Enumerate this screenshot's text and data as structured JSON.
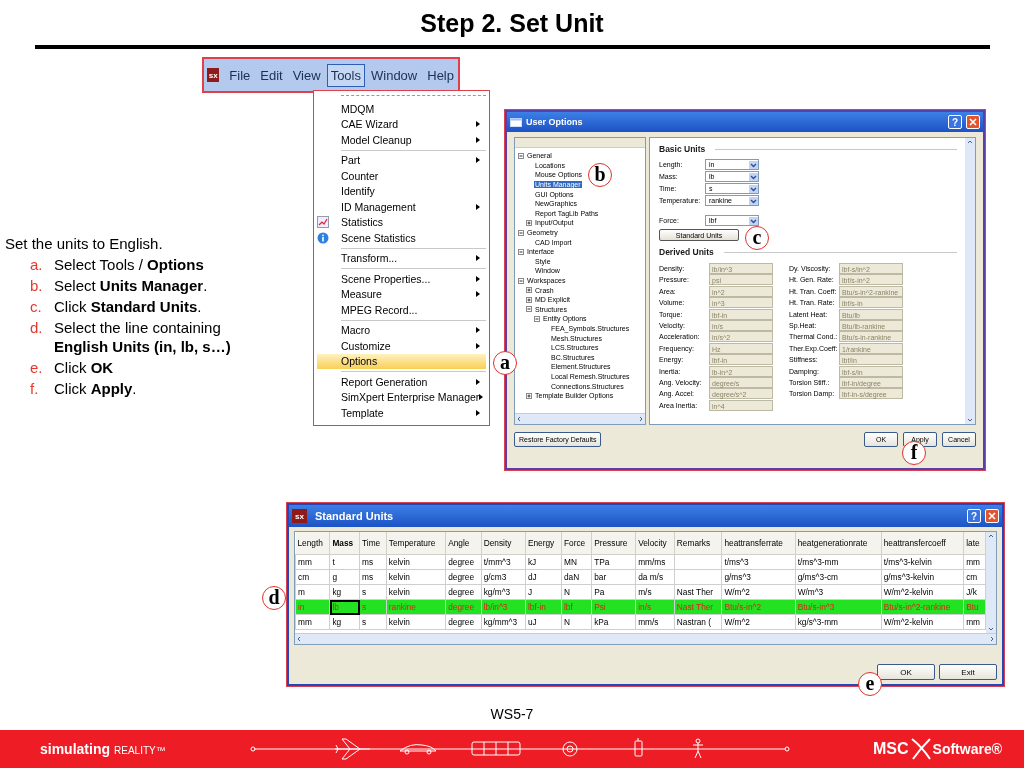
{
  "slide_title": "Step 2. Set Unit",
  "instructions": {
    "intro": "Set the units to English.",
    "steps": [
      {
        "marker": "a.",
        "text": "Select Tools / **Options**"
      },
      {
        "marker": "b.",
        "text": "Select **Units Manager**."
      },
      {
        "marker": "c.",
        "text": "Click **Standard Units**."
      },
      {
        "marker": "d.",
        "text": "Select the line containing **English Units (in, lb, s…)**"
      },
      {
        "marker": "e.",
        "text": "Click **OK**"
      },
      {
        "marker": "f.",
        "text": "Click **Apply**."
      }
    ]
  },
  "menubar": {
    "logo": "sx",
    "items": [
      {
        "label": "File",
        "selected": false
      },
      {
        "label": "Edit",
        "selected": false
      },
      {
        "label": "View",
        "selected": false
      },
      {
        "label": "Tools",
        "selected": true
      },
      {
        "label": "Window",
        "selected": false
      },
      {
        "label": "Help",
        "selected": false
      }
    ]
  },
  "tools_menu": {
    "groups": [
      [
        {
          "label": "MDQM",
          "kind": "plain",
          "submenu": false,
          "selected": false
        },
        {
          "label": "CAE Wizard",
          "kind": "plain",
          "submenu": true,
          "selected": false
        },
        {
          "label": "Model Cleanup",
          "kind": "plain",
          "submenu": true,
          "selected": false
        }
      ],
      [
        {
          "label": "Part",
          "kind": "plain",
          "submenu": true,
          "selected": false
        },
        {
          "label": "Counter",
          "kind": "plain",
          "submenu": false,
          "selected": false
        },
        {
          "label": "Identify",
          "kind": "plain",
          "submenu": false,
          "selected": false
        },
        {
          "label": "ID Management",
          "kind": "plain",
          "submenu": true,
          "selected": false
        },
        {
          "label": "Statistics",
          "kind": "chart",
          "submenu": false,
          "selected": false
        },
        {
          "label": "Scene Statistics",
          "kind": "info",
          "submenu": false,
          "selected": false
        }
      ],
      [
        {
          "label": "Transform...",
          "kind": "plain",
          "submenu": true,
          "selected": false
        }
      ],
      [
        {
          "label": "Scene Properties...",
          "kind": "plain",
          "submenu": true,
          "selected": false
        },
        {
          "label": "Measure",
          "kind": "plain",
          "submenu": true,
          "selected": false
        },
        {
          "label": "MPEG Record...",
          "kind": "plain",
          "submenu": false,
          "selected": false
        }
      ],
      [
        {
          "label": "Macro",
          "kind": "plain",
          "submenu": true,
          "selected": false
        },
        {
          "label": "Customize",
          "kind": "plain",
          "submenu": true,
          "selected": false
        },
        {
          "label": "Options",
          "kind": "plain",
          "submenu": false,
          "selected": true
        }
      ],
      [
        {
          "label": "Report Generation",
          "kind": "plain",
          "submenu": true,
          "selected": false
        },
        {
          "label": "SimXpert Enterprise Manager",
          "kind": "plain",
          "submenu": true,
          "selected": false
        },
        {
          "label": "Template",
          "kind": "plain",
          "submenu": true,
          "selected": false
        }
      ]
    ]
  },
  "user_options": {
    "title": "User Options",
    "help_label": "?",
    "tree": [
      {
        "label": "General",
        "selected": false,
        "expanded": true,
        "children": [
          {
            "label": "Locations",
            "selected": false
          },
          {
            "label": "Mouse Options",
            "selected": false
          },
          {
            "label": "Units Manager",
            "selected": true
          },
          {
            "label": "GUI Options",
            "selected": false
          },
          {
            "label": "NewGraphics",
            "selected": false
          },
          {
            "label": "Report TagLib Paths",
            "selected": false
          },
          {
            "label": "Input/Output",
            "selected": false,
            "expanded": false
          }
        ]
      },
      {
        "label": "Geometry",
        "selected": false,
        "expanded": true,
        "children": [
          {
            "label": "CAD Import",
            "selected": false
          }
        ]
      },
      {
        "label": "Interface",
        "selected": false,
        "expanded": true,
        "children": [
          {
            "label": "Style",
            "selected": false
          },
          {
            "label": "Window",
            "selected": false
          }
        ]
      },
      {
        "label": "Workspaces",
        "selected": false,
        "expanded": true,
        "children": [
          {
            "label": "Crash",
            "selected": false,
            "expanded": false
          },
          {
            "label": "MD Explicit",
            "selected": false,
            "expanded": false
          },
          {
            "label": "Structures",
            "selected": false,
            "expanded": true,
            "children": [
              {
                "label": "Entity Options",
                "selected": false,
                "expanded": true,
                "children": [
                  {
                    "label": "FEA_Symbols.Structures",
                    "selected": false
                  },
                  {
                    "label": "Mesh.Structures",
                    "selected": false
                  },
                  {
                    "label": "LCS.Structures",
                    "selected": false
                  },
                  {
                    "label": "BC.Structures",
                    "selected": false
                  },
                  {
                    "label": "Element.Structures",
                    "selected": false
                  },
                  {
                    "label": "Local Remesh.Structures",
                    "selected": false
                  },
                  {
                    "label": "Connections.Structures",
                    "selected": false
                  }
                ]
              }
            ]
          },
          {
            "label": "Template Builder Options",
            "selected": false,
            "expanded": false
          }
        ]
      }
    ],
    "basic_units": {
      "heading": "Basic Units",
      "fields": [
        {
          "label": "Length:",
          "value": "in"
        },
        {
          "label": "Mass:",
          "value": "lb"
        },
        {
          "label": "Time:",
          "value": "s"
        },
        {
          "label": "Temperature:",
          "value": "rankine"
        }
      ],
      "force": {
        "label": "Force:",
        "value": "lbf"
      },
      "button": "Standard Units"
    },
    "derived_units": {
      "heading": "Derived Units",
      "left": [
        {
          "label": "Density:",
          "value": "lb/in^3"
        },
        {
          "label": "Pressure:",
          "value": "psi"
        },
        {
          "label": "Area:",
          "value": "in^2"
        },
        {
          "label": "Volume:",
          "value": "in^3"
        },
        {
          "label": "Torque:",
          "value": "lbf-in"
        },
        {
          "label": "Velocity:",
          "value": "in/s"
        },
        {
          "label": "Acceleration:",
          "value": "in/s^2"
        },
        {
          "label": "Frequency:",
          "value": "Hz"
        },
        {
          "label": "Energy:",
          "value": "lbf-in"
        },
        {
          "label": "Inertia:",
          "value": "lb-in^2"
        },
        {
          "label": "Ang. Velocity:",
          "value": "degree/s"
        },
        {
          "label": "Ang. Accel:",
          "value": "degree/s^2"
        },
        {
          "label": "Area Inertia:",
          "value": "in^4"
        }
      ],
      "right": [
        {
          "label": "Dy. Viscosity:",
          "value": "lbf-s/in^2"
        },
        {
          "label": "Ht. Gen. Rate:",
          "value": "lbf/s-in^2"
        },
        {
          "label": "Ht. Tran. Coeff:",
          "value": "Btu/s-in^2-rankine"
        },
        {
          "label": "Ht. Tran. Rate:",
          "value": "lbf/s-in"
        },
        {
          "label": "Latent Heat:",
          "value": "Btu/lb"
        },
        {
          "label": "Sp.Heat:",
          "value": "Btu/lb-rankine"
        },
        {
          "label": "Thermal Cond.:",
          "value": "Btu/s-in-rankine"
        },
        {
          "label": "Ther.Exp.Coeff:",
          "value": "1/rankine"
        },
        {
          "label": "Stiffness:",
          "value": "lbf/in"
        },
        {
          "label": "Damping:",
          "value": "lbf-s/in"
        },
        {
          "label": "Torsion Stiff.:",
          "value": "lbf-in/degree"
        },
        {
          "label": "Torsion Damp:",
          "value": "lbf-in-s/degree"
        }
      ]
    },
    "buttons": {
      "restore": "Restore Factory Defaults",
      "ok": "OK",
      "apply": "Apply",
      "cancel": "Cancel"
    }
  },
  "standard_units": {
    "title": "Standard Units",
    "logo": "sx",
    "help_label": "?",
    "columns": [
      {
        "label": "Length",
        "sorted": false
      },
      {
        "label": "Mass",
        "sorted": true
      },
      {
        "label": "Time",
        "sorted": false
      },
      {
        "label": "Temperature",
        "sorted": false
      },
      {
        "label": "Angle",
        "sorted": false
      },
      {
        "label": "Density",
        "sorted": false
      },
      {
        "label": "Energy",
        "sorted": false
      },
      {
        "label": "Force",
        "sorted": false
      },
      {
        "label": "Pressure",
        "sorted": false
      },
      {
        "label": "Velocity",
        "sorted": false
      },
      {
        "label": "Remarks",
        "sorted": false
      },
      {
        "label": "heattransferrate",
        "sorted": false
      },
      {
        "label": "heatgenerationrate",
        "sorted": false
      },
      {
        "label": "heattransfercoeff",
        "sorted": false
      },
      {
        "label": "late",
        "sorted": false
      }
    ],
    "rows": [
      {
        "selected": false,
        "focused": false,
        "cells": [
          "mm",
          "t",
          "ms",
          "kelvin",
          "degree",
          "t/mm^3",
          "kJ",
          "MN",
          "TPa",
          "mm/ms",
          null,
          "t/ms^3",
          "t/ms^3-mm",
          "t/ms^3-kelvin",
          "mm"
        ]
      },
      {
        "selected": false,
        "focused": false,
        "cells": [
          "cm",
          "g",
          "ms",
          "kelvin",
          "degree",
          "g/cm3",
          "dJ",
          "daN",
          "bar",
          "da m/s",
          null,
          "g/ms^3",
          "g/ms^3-cm",
          "g/ms^3-kelvin",
          "cm"
        ]
      },
      {
        "selected": false,
        "focused": false,
        "cells": [
          "m",
          "kg",
          "s",
          "kelvin",
          "degree",
          "kg/m^3",
          "J",
          "N",
          "Pa",
          "m/s",
          "Nast Ther",
          "W/m^2",
          "W/m^3",
          "W/m^2-kelvin",
          "J/k"
        ]
      },
      {
        "selected": true,
        "focused": true,
        "cells": [
          "in",
          "lb",
          "s",
          "rankine",
          "degree",
          "lb/in^3",
          "lbf-in",
          "lbf",
          "Psi",
          "in/s",
          "Nast Ther",
          "Btu/s-in^2",
          "Btu/s-in^3",
          "Btu/s-in^2-rankine",
          "Btu"
        ]
      },
      {
        "selected": false,
        "focused": false,
        "cells": [
          "mm",
          "kg",
          "s",
          "kelvin",
          "degree",
          "kg/mm^3",
          "uJ",
          "N",
          "kPa",
          "mm/s",
          "Nastran (",
          "W/m^2",
          "kg/s^3-mm",
          "W/m^2-kelvin",
          "mm"
        ]
      }
    ],
    "buttons": {
      "ok": "OK",
      "exit": "Exit"
    }
  },
  "callouts": [
    "a",
    "b",
    "c",
    "d",
    "e",
    "f"
  ],
  "page_number": "WS5-7",
  "footer": {
    "tagline": "simulating",
    "tagline_suffix": "REALITY™",
    "brand": "MSC",
    "brand_suffix": "Software®"
  }
}
